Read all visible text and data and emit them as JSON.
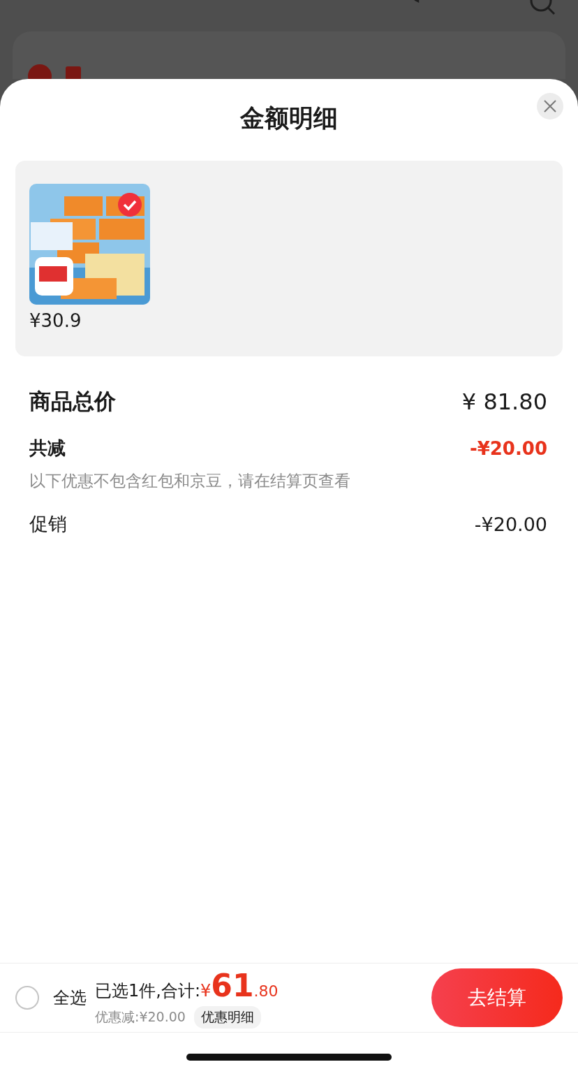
{
  "background": {
    "store": {
      "checked": true
    }
  },
  "sheet": {
    "title": "金额明细",
    "products": [
      {
        "price": "¥30.9",
        "selected": true
      }
    ],
    "summary": [
      {
        "kind": "total",
        "label": "商品总价",
        "value": "¥ 81.80"
      },
      {
        "kind": "discount",
        "label": "共减",
        "value": "-¥20.00",
        "note": "以下优惠不包含红包和京豆，请在结算页查看"
      },
      {
        "kind": "item",
        "label": "促销",
        "value": "-¥20.00"
      }
    ]
  },
  "bottom_bar": {
    "select_all": {
      "label": "全选",
      "checked": false
    },
    "summary": "已选1件,合计:",
    "total_symbol": "¥",
    "total_main": "61",
    "total_decimal": ".80",
    "discount": "优惠减:¥20.00",
    "detail_button": "优惠明细",
    "checkout": "去结算"
  }
}
